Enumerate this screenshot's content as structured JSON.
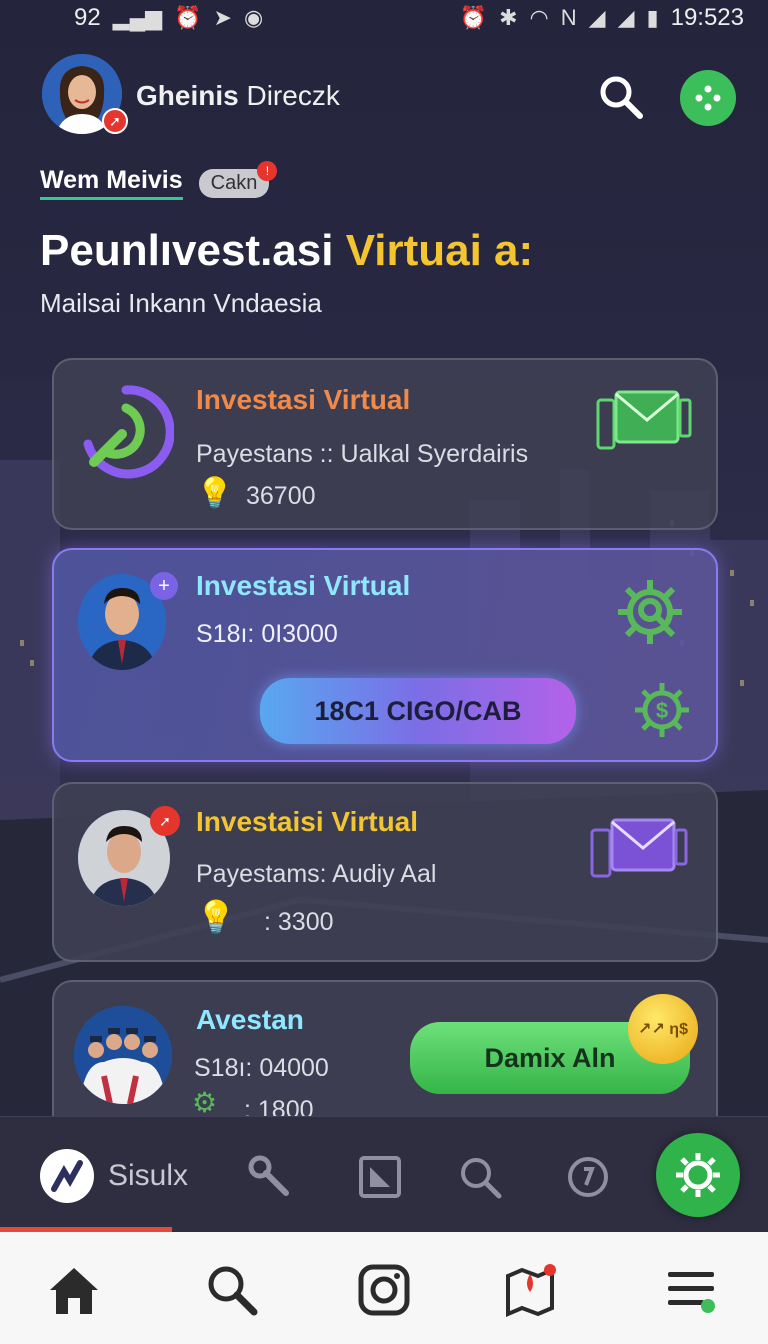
{
  "status_bar": {
    "left_text": "92",
    "time": "19:523"
  },
  "header": {
    "name_bold": "Gheinis",
    "name_rest": " Direczk",
    "subtitle_label": "Wem Meivis",
    "chip_label": "Cakn",
    "title_white": "Peunlıvest.asi ",
    "title_yellow": "Virtuai a:",
    "subtitle": "Mailsai Inkann Vndaesia"
  },
  "cards": [
    {
      "title": "Investasi Virtual",
      "title_color": "#f08a4a",
      "line1": "Payestans :: Ualkal Syerdairis",
      "value": "36700"
    },
    {
      "title": "Investasi Virtual",
      "title_color": "#8fe8ff",
      "line1": "S18ı: 0I3000",
      "button_label": "18C1 CIGO/CAB"
    },
    {
      "title": "Investaisi Virtual",
      "title_color": "#f3c531",
      "line1": "Payestams: Audiy Aal",
      "value": ": 3300"
    },
    {
      "title": "Avestan",
      "title_color": "#8fe8ff",
      "line1": "S18ı: 04000",
      "value": ": 1800",
      "button_label": "Damix Aln",
      "coin_label": "↗↗ η$"
    }
  ],
  "dock": {
    "label": "Sisulx",
    "accent": "#e5493a"
  },
  "icons": {
    "status_left": [
      "signal-icon",
      "alarm-icon",
      "location-icon",
      "record-icon"
    ],
    "status_right": [
      "alarm-icon",
      "bluetooth-icon",
      "wifi-icon",
      "mute-icon",
      "signal-icon",
      "signal-icon",
      "battery-icon"
    ],
    "bottom_nav": [
      "home-icon",
      "search-icon",
      "instagram-icon",
      "map-icon",
      "menu-icon"
    ]
  },
  "colors": {
    "background": "#25253d",
    "green_accent": "#3cbf5a",
    "title_yellow": "#f3c531",
    "highlight_border": "#8a7bf0"
  }
}
